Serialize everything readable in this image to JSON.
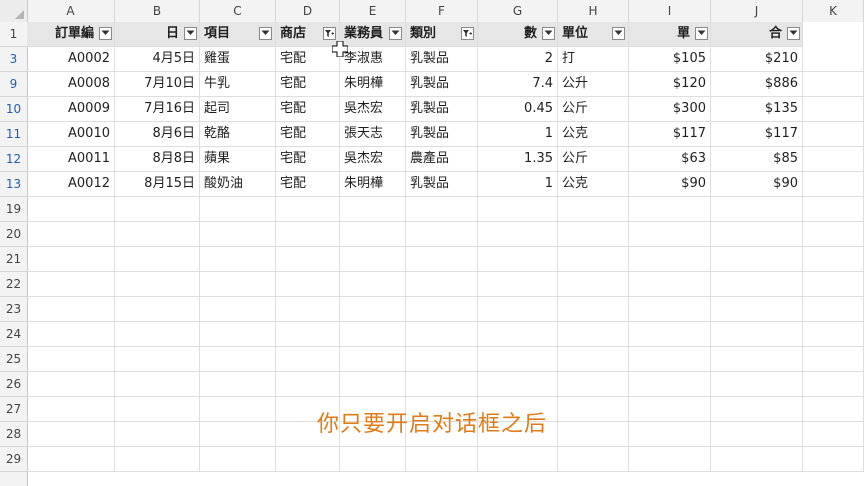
{
  "columns": [
    "A",
    "B",
    "C",
    "D",
    "E",
    "F",
    "G",
    "H",
    "I",
    "J",
    "K"
  ],
  "header_row": {
    "row_number": "1",
    "cells": [
      "訂單編",
      "日",
      "項目",
      "商店",
      "業務員",
      "類別",
      "數",
      "單位",
      "單",
      "合"
    ],
    "filter_state": [
      "dropdown",
      "dropdown",
      "dropdown",
      "filtered",
      "dropdown",
      "filtered",
      "dropdown",
      "dropdown",
      "dropdown",
      "dropdown"
    ]
  },
  "rows": [
    {
      "row_number": "3",
      "cells": [
        "A0002",
        "4月5日",
        "雞蛋",
        "宅配",
        "李淑惠",
        "乳製品",
        "2",
        "打",
        "$105",
        "$210"
      ]
    },
    {
      "row_number": "9",
      "cells": [
        "A0008",
        "7月10日",
        "牛乳",
        "宅配",
        "朱明樺",
        "乳製品",
        "7.4",
        "公升",
        "$120",
        "$886"
      ]
    },
    {
      "row_number": "10",
      "cells": [
        "A0009",
        "7月16日",
        "起司",
        "宅配",
        "吳杰宏",
        "乳製品",
        "0.45",
        "公斤",
        "$300",
        "$135"
      ]
    },
    {
      "row_number": "11",
      "cells": [
        "A0010",
        "8月6日",
        "乾酪",
        "宅配",
        "張天志",
        "乳製品",
        "1",
        "公克",
        "$117",
        "$117"
      ]
    },
    {
      "row_number": "12",
      "cells": [
        "A0011",
        "8月8日",
        "蘋果",
        "宅配",
        "吳杰宏",
        "農產品",
        "1.35",
        "公斤",
        "$63",
        "$85"
      ]
    },
    {
      "row_number": "13",
      "cells": [
        "A0012",
        "8月15日",
        "酸奶油",
        "宅配",
        "朱明樺",
        "乳製品",
        "1",
        "公克",
        "$90",
        "$90"
      ]
    }
  ],
  "empty_rows": [
    "19",
    "20",
    "21",
    "22",
    "23",
    "24",
    "25",
    "26",
    "27",
    "28",
    "29"
  ],
  "subtitle": "你只要开启对话框之后",
  "colors": {
    "subtitle": "#e07c16",
    "filtered_row_number": "#1e5fb3",
    "header_fill": "#e6e6e6"
  }
}
